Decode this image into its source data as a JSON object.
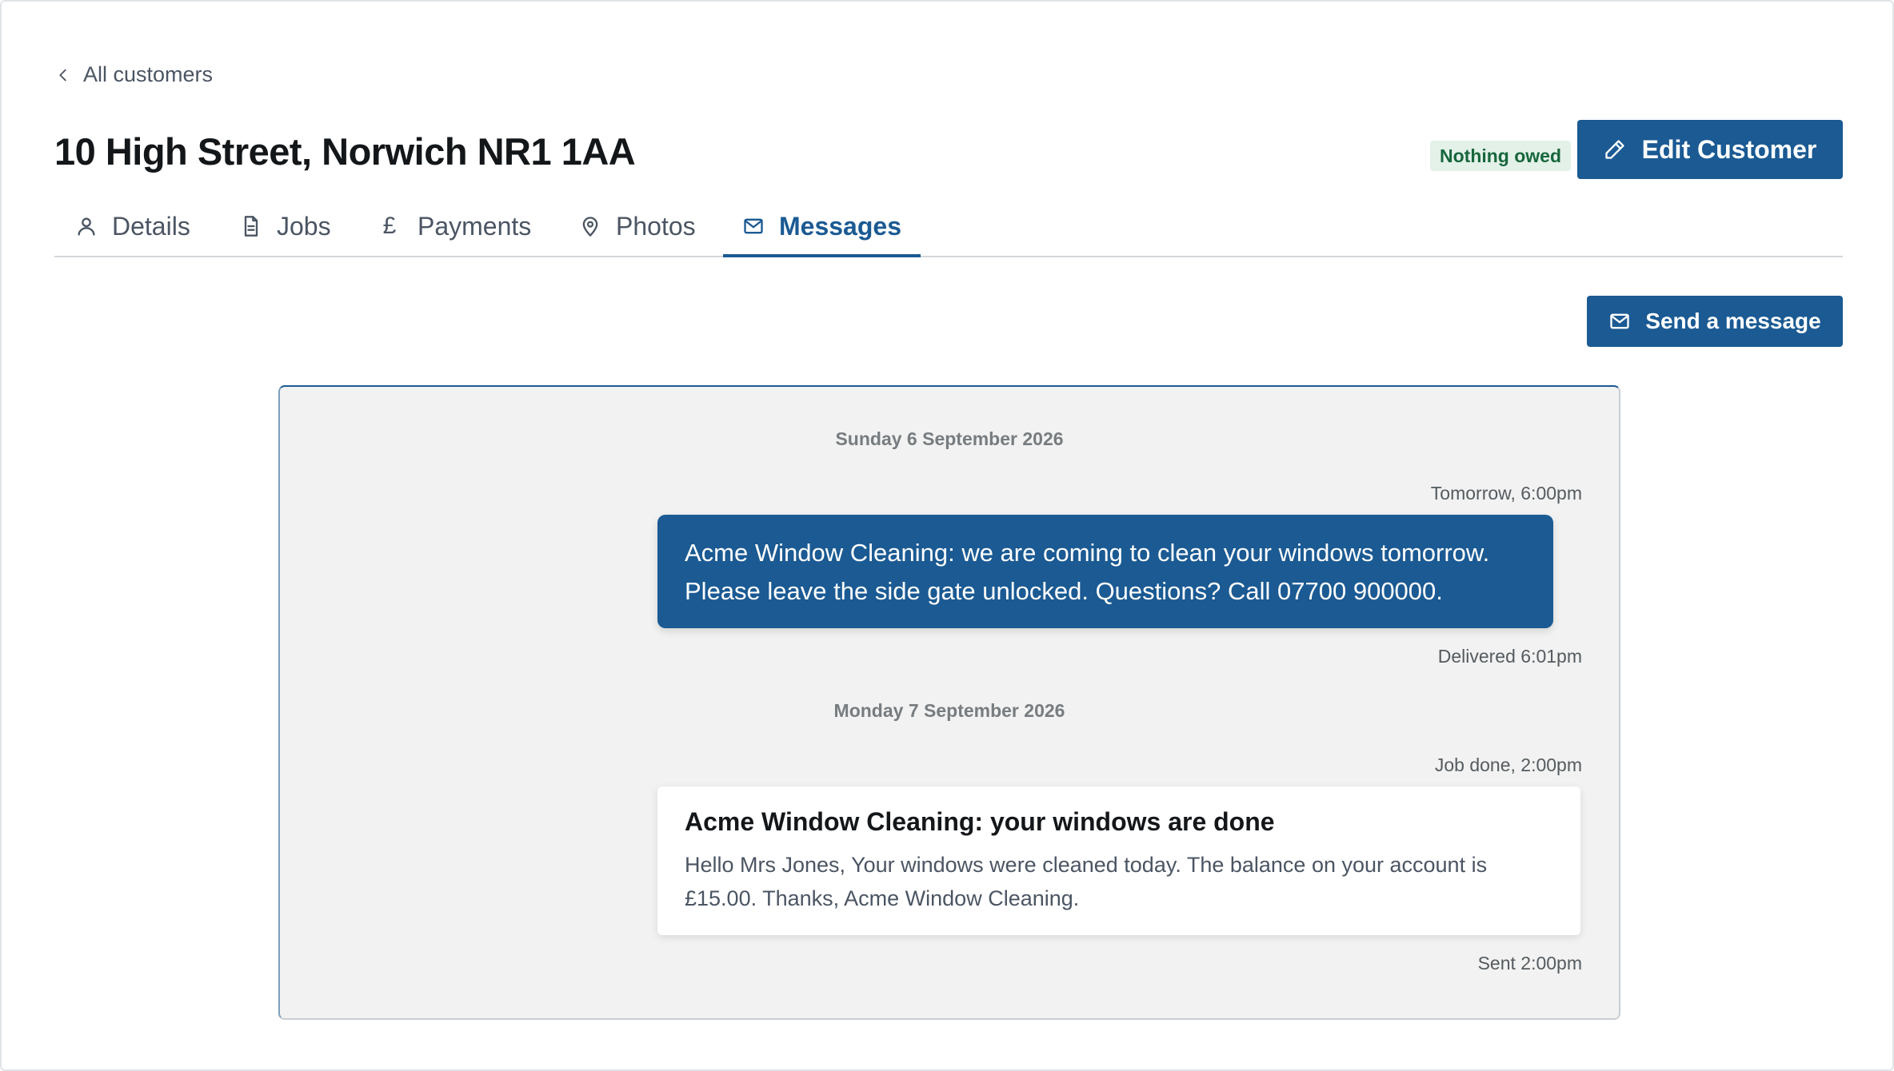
{
  "breadcrumb": {
    "back_label": "All customers"
  },
  "header": {
    "title": "10 High Street, Norwich NR1 1AA",
    "status_badge": "Nothing owed",
    "edit_label": "Edit Customer"
  },
  "tabs": [
    {
      "label": "Details",
      "icon": "user-icon"
    },
    {
      "label": "Jobs",
      "icon": "document-icon"
    },
    {
      "label": "Payments",
      "icon": "pound-icon"
    },
    {
      "label": "Photos",
      "icon": "location-pin-icon"
    },
    {
      "label": "Messages",
      "icon": "envelope-icon",
      "active": true
    }
  ],
  "actions": {
    "send_label": "Send a message"
  },
  "thread": {
    "days": [
      {
        "date": "Sunday 6 September 2026",
        "message": {
          "kind": "sms",
          "time_label": "Tomorrow, 6:00pm",
          "text": "Acme Window Cleaning: we are coming to clean your windows tomorrow. Please leave the side gate unlocked. Questions? Call 07700 900000.",
          "status": "Delivered 6:01pm"
        }
      },
      {
        "date": "Monday 7 September 2026",
        "message": {
          "kind": "email",
          "time_label": "Job done, 2:00pm",
          "subject": "Acme Window Cleaning: your windows are done",
          "body": "Hello Mrs Jones, Your windows were cleaned today. The balance on your account is £15.00. Thanks, Acme Window Cleaning.",
          "status": "Sent 2:00pm"
        }
      }
    ]
  },
  "colors": {
    "primary": "#1b5a93",
    "badge_bg": "#e3f1e9",
    "badge_text": "#17663c",
    "thread_bg": "#f1f2f1"
  }
}
